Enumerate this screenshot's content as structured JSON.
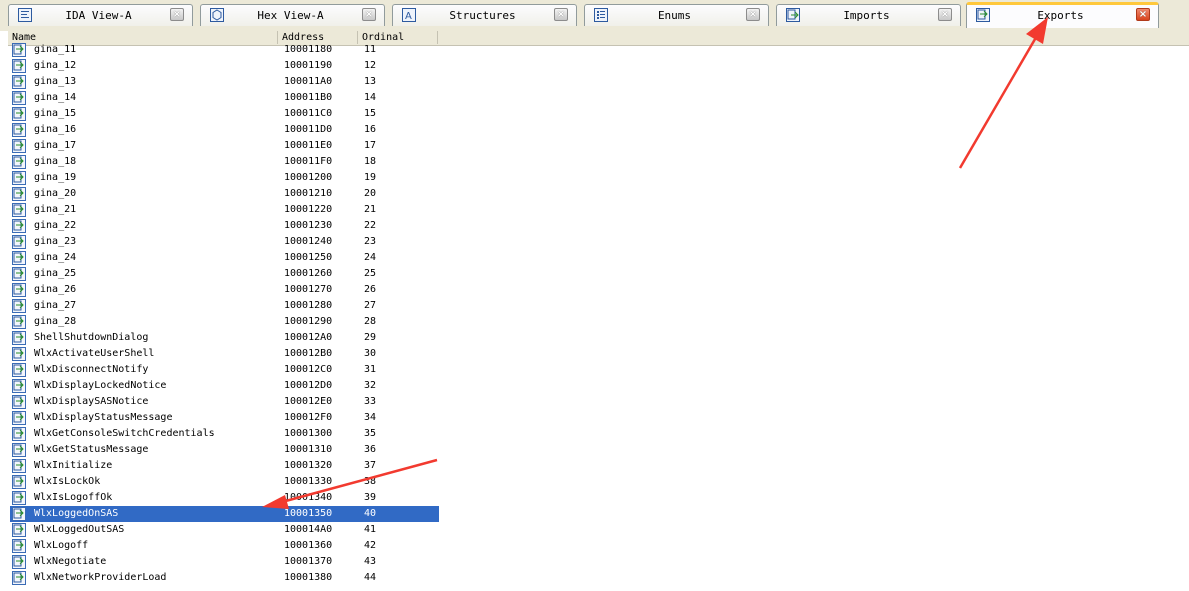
{
  "tabs": [
    {
      "label": "IDA View-A",
      "icon": "ida-view-icon"
    },
    {
      "label": "Hex View-A",
      "icon": "hex-view-icon"
    },
    {
      "label": "Structures",
      "icon": "structures-icon"
    },
    {
      "label": "Enums",
      "icon": "enums-icon"
    },
    {
      "label": "Imports",
      "icon": "imports-icon"
    },
    {
      "label": "Exports",
      "icon": "exports-icon",
      "active": true
    }
  ],
  "close_glyph": "×",
  "columns": {
    "name": "Name",
    "address": "Address",
    "ordinal": "Ordinal"
  },
  "selected_row_index": 29,
  "colors": {
    "selection": "#316ac5",
    "arrow": "#f23a2f",
    "active_tab_accent": "#ffc83c"
  },
  "rows": [
    {
      "name": "gina_11",
      "address": "10001180",
      "ordinal": "11"
    },
    {
      "name": "gina_12",
      "address": "10001190",
      "ordinal": "12"
    },
    {
      "name": "gina_13",
      "address": "100011A0",
      "ordinal": "13"
    },
    {
      "name": "gina_14",
      "address": "100011B0",
      "ordinal": "14"
    },
    {
      "name": "gina_15",
      "address": "100011C0",
      "ordinal": "15"
    },
    {
      "name": "gina_16",
      "address": "100011D0",
      "ordinal": "16"
    },
    {
      "name": "gina_17",
      "address": "100011E0",
      "ordinal": "17"
    },
    {
      "name": "gina_18",
      "address": "100011F0",
      "ordinal": "18"
    },
    {
      "name": "gina_19",
      "address": "10001200",
      "ordinal": "19"
    },
    {
      "name": "gina_20",
      "address": "10001210",
      "ordinal": "20"
    },
    {
      "name": "gina_21",
      "address": "10001220",
      "ordinal": "21"
    },
    {
      "name": "gina_22",
      "address": "10001230",
      "ordinal": "22"
    },
    {
      "name": "gina_23",
      "address": "10001240",
      "ordinal": "23"
    },
    {
      "name": "gina_24",
      "address": "10001250",
      "ordinal": "24"
    },
    {
      "name": "gina_25",
      "address": "10001260",
      "ordinal": "25"
    },
    {
      "name": "gina_26",
      "address": "10001270",
      "ordinal": "26"
    },
    {
      "name": "gina_27",
      "address": "10001280",
      "ordinal": "27"
    },
    {
      "name": "gina_28",
      "address": "10001290",
      "ordinal": "28"
    },
    {
      "name": "ShellShutdownDialog",
      "address": "100012A0",
      "ordinal": "29"
    },
    {
      "name": "WlxActivateUserShell",
      "address": "100012B0",
      "ordinal": "30"
    },
    {
      "name": "WlxDisconnectNotify",
      "address": "100012C0",
      "ordinal": "31"
    },
    {
      "name": "WlxDisplayLockedNotice",
      "address": "100012D0",
      "ordinal": "32"
    },
    {
      "name": "WlxDisplaySASNotice",
      "address": "100012E0",
      "ordinal": "33"
    },
    {
      "name": "WlxDisplayStatusMessage",
      "address": "100012F0",
      "ordinal": "34"
    },
    {
      "name": "WlxGetConsoleSwitchCredentials",
      "address": "10001300",
      "ordinal": "35"
    },
    {
      "name": "WlxGetStatusMessage",
      "address": "10001310",
      "ordinal": "36"
    },
    {
      "name": "WlxInitialize",
      "address": "10001320",
      "ordinal": "37"
    },
    {
      "name": "WlxIsLockOk",
      "address": "10001330",
      "ordinal": "38"
    },
    {
      "name": "WlxIsLogoffOk",
      "address": "10001340",
      "ordinal": "39"
    },
    {
      "name": "WlxLoggedOnSAS",
      "address": "10001350",
      "ordinal": "40"
    },
    {
      "name": "WlxLoggedOutSAS",
      "address": "100014A0",
      "ordinal": "41"
    },
    {
      "name": "WlxLogoff",
      "address": "10001360",
      "ordinal": "42"
    },
    {
      "name": "WlxNegotiate",
      "address": "10001370",
      "ordinal": "43"
    },
    {
      "name": "WlxNetworkProviderLoad",
      "address": "10001380",
      "ordinal": "44"
    }
  ]
}
